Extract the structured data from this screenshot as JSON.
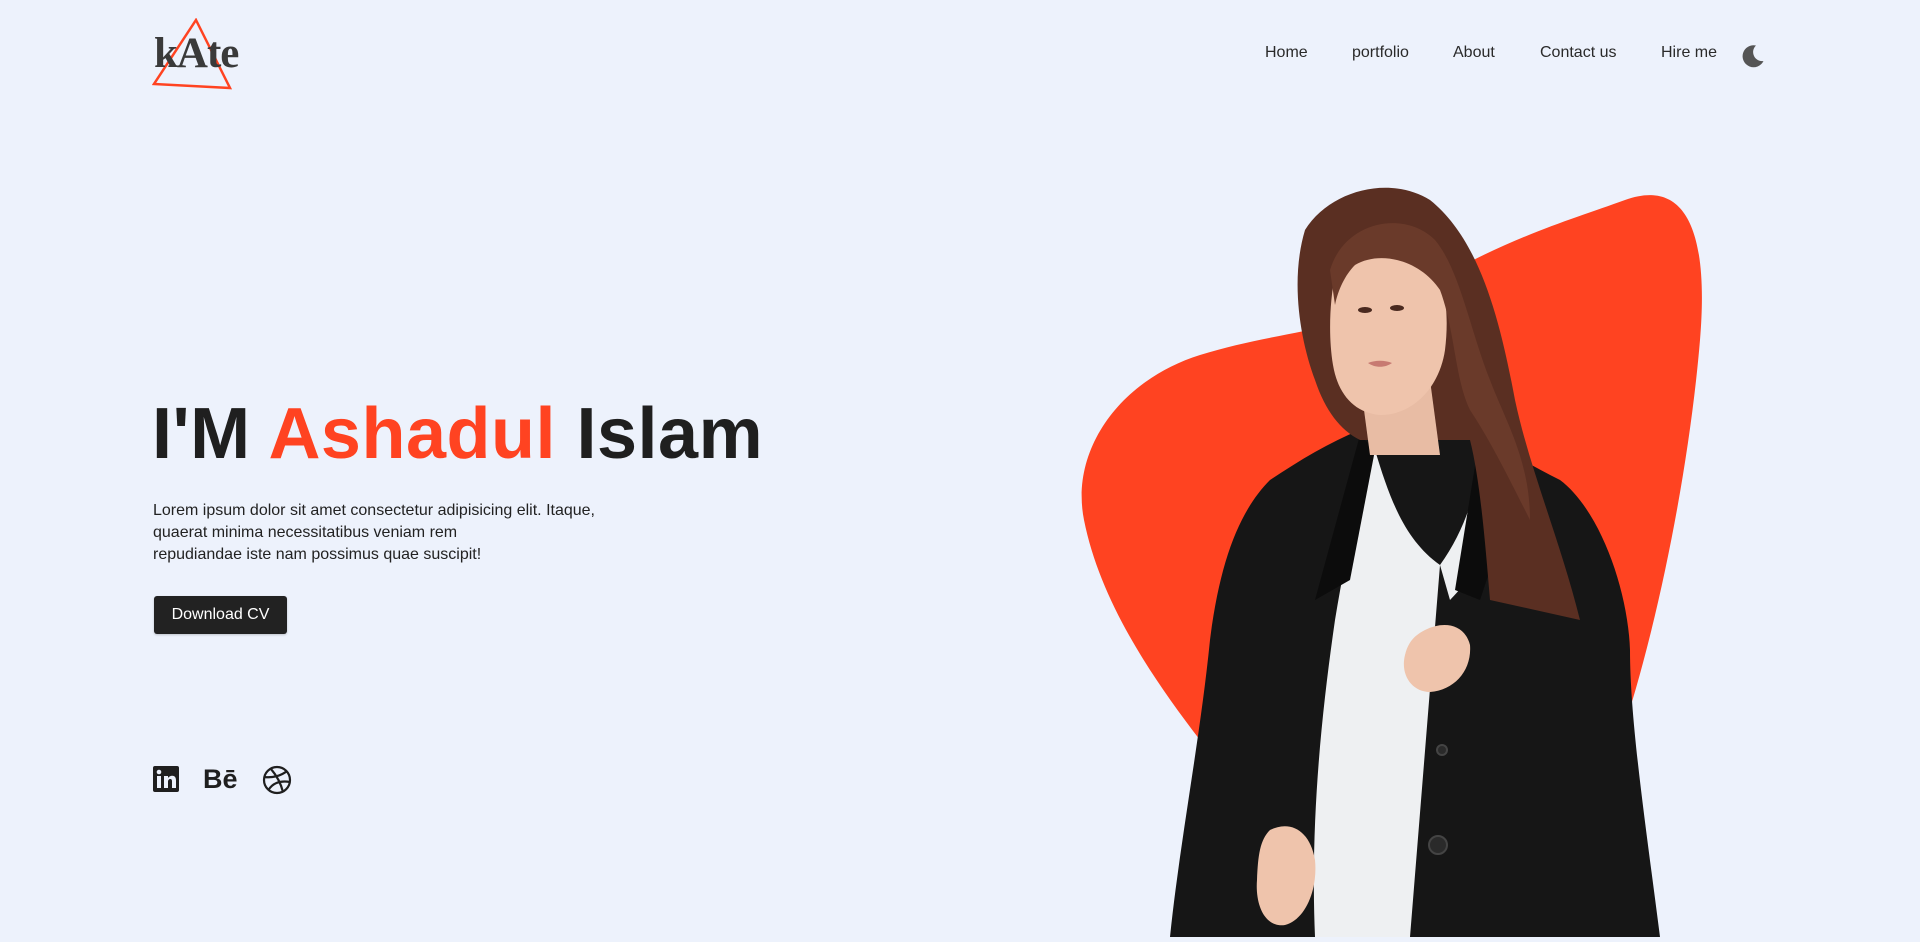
{
  "brand": {
    "logo_text": "kAte",
    "accent_color": "#ff4321"
  },
  "nav": {
    "items": [
      {
        "label": "Home"
      },
      {
        "label": "portfolio"
      },
      {
        "label": "About"
      },
      {
        "label": "Contact us"
      },
      {
        "label": "Hire me"
      }
    ],
    "theme_toggle_icon": "moon-icon"
  },
  "hero": {
    "title_prefix": "I'M ",
    "title_highlight": "Ashadul",
    "title_suffix": " Islam",
    "description_lines": [
      "Lorem ipsum dolor sit amet consectetur adipisicing elit. Itaque,",
      "quaerat minima necessitatibus veniam rem",
      "repudiandae iste nam possimus quae suscipit!"
    ],
    "cta_label": "Download CV"
  },
  "socials": [
    {
      "icon": "linkedin-icon"
    },
    {
      "icon": "behance-icon",
      "glyph": "Bē"
    },
    {
      "icon": "dribbble-icon"
    }
  ],
  "colors": {
    "background": "#edf2fc",
    "text": "#202020",
    "button": "#222222"
  }
}
